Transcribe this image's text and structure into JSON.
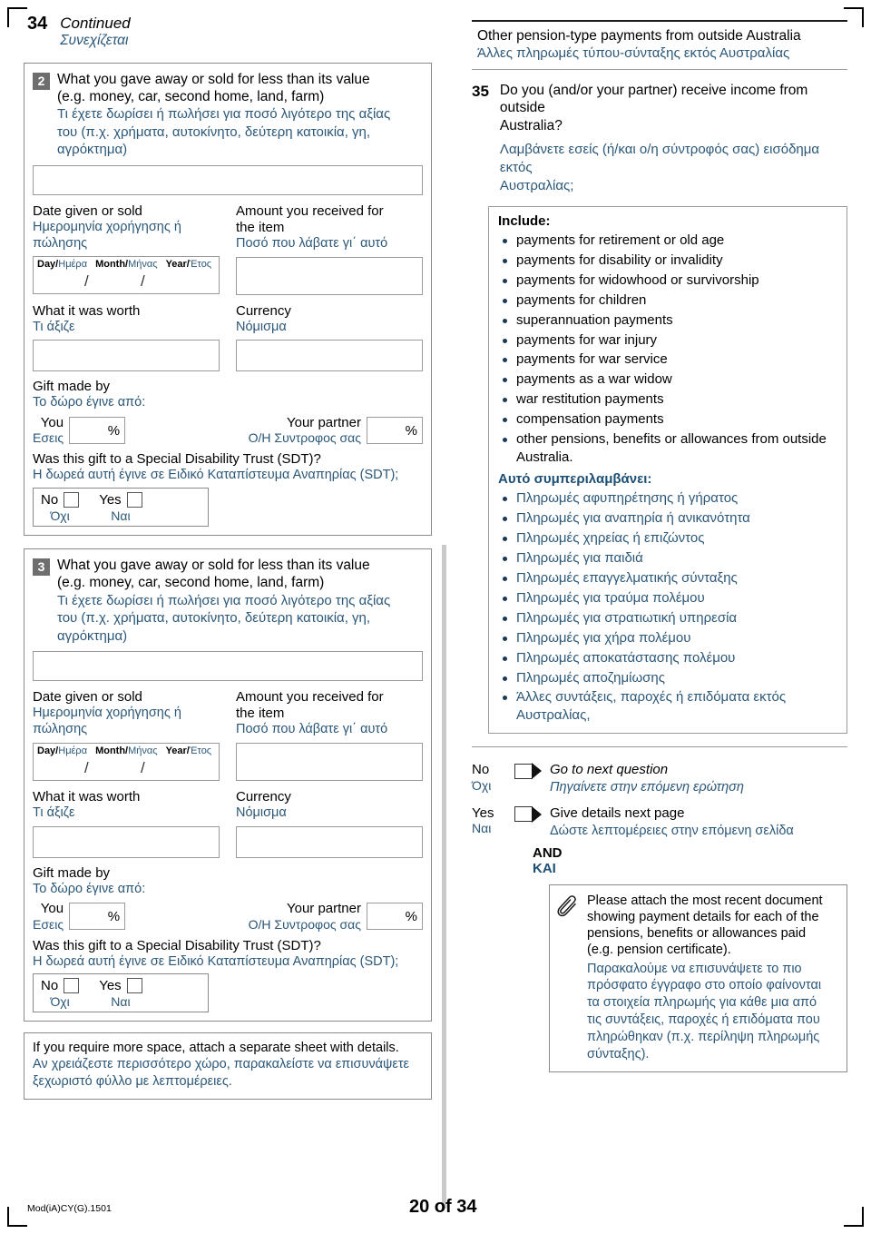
{
  "page": {
    "continued_number": "34",
    "continued_en": "Continued",
    "continued_gr": "Συνεχίζεται",
    "footer_code": "Mod(iA)CY(G).1501",
    "footer_page": "20 of 34",
    "accent_color": "#2b5778",
    "badge_color": "#6e6e6e"
  },
  "gift_labels": {
    "title_en_1": "What you gave away or sold for less than its value",
    "title_en_2": "(e.g. money, car, second home, land, farm)",
    "title_gr_1": "Τι έχετε δωρίσει ή πωλήσει για ποσό λιγότερο της αξίας",
    "title_gr_2": "του (π.χ. χρήματα, αυτοκίνητο, δεύτερη κατοικία, γη,",
    "title_gr_3": "αγρόκτημα)",
    "date_en": "Date given or sold",
    "date_gr_1": "Ημερομηνία χορήγησης ή",
    "date_gr_2": "πώλησης",
    "day_en": "Day/",
    "day_gr": "Ημέρα",
    "month_en": "Month/",
    "month_gr": "Μήνας",
    "year_en": "Year/",
    "year_gr": "Έτος",
    "amount_en_1": "Amount you received for",
    "amount_en_2": "the item",
    "amount_gr": "Ποσό που λάβατε γι΄ αυτό",
    "worth_en": "What it was worth",
    "worth_gr": "Τι άξιζε",
    "currency_en": "Currency",
    "currency_gr": "Νόμισμα",
    "giftby_en": "Gift made by",
    "giftby_gr": "Το δώρο έγινε από:",
    "you_en": "You",
    "you_gr": "Εσεις",
    "partner_en": "Your partner",
    "partner_gr": "Ο/Η Συντροφος σας",
    "percent_symbol": "%",
    "sdt_en": "Was this gift to a Special Disability Trust (SDT)?",
    "sdt_gr": "Η δωρεά αυτή έγινε σε Ειδικό Καταπίστευμα Αναπηρίας (SDT);",
    "no_en": "No",
    "no_gr": "Όχι",
    "yes_en": "Yes",
    "yes_gr": "Ναι"
  },
  "gift_items": [
    {
      "number": "2"
    },
    {
      "number": "3"
    }
  ],
  "more_space": {
    "en": "If you require more space, attach a separate sheet with details.",
    "gr_1": "Αν χρειάζεστε περισσότερο χώρο, παρακαλείστε να επισυνάψετε",
    "gr_2": "ξεχωριστό φύλλο με λεπτομέρειες."
  },
  "section": {
    "title_en": "Other pension-type payments from outside Australia",
    "title_gr": "Άλλες πληρωμές τύπου-σύνταξης εκτός Αυστραλίας"
  },
  "question35": {
    "number": "35",
    "en_1": "Do you (and/or your partner) receive income from outside",
    "en_2": "Australia?",
    "gr_1": "Λαμβάνετε εσείς (ή/και ο/η σύντροφός σας) εισόδημα εκτός",
    "gr_2": "Αυστραλίας;",
    "include_heading_en": "Include:",
    "include_heading_gr": "Αυτό συμπεριλαμβάνει:",
    "include_en": [
      "payments for retirement or old age",
      "payments for disability or invalidity",
      "payments for widowhood or survivorship",
      "payments for children",
      "superannuation payments",
      "payments for war injury",
      "payments for war service",
      "payments as a war widow",
      "war restitution payments",
      "compensation payments",
      "other pensions, benefits or allowances from outside Australia."
    ],
    "include_gr": [
      "Πληρωμές αφυπηρέτησης ή γήρατος",
      "Πληρωμές για αναπηρία ή ανικανότητα",
      "Πληρωμές χηρείας ή επιζώντος",
      "Πληρωμές για παιδιά",
      "Πληρωμές επαγγελματικής σύνταξης",
      "Πληρωμές για τραύμα πολέμου",
      "Πληρωμές για στρατιωτική υπηρεσία",
      "Πληρωμές για χήρα πολέμου",
      "Πληρωμές αποκατάστασης πολέμου",
      "Πληρωμές αποζημίωσης",
      "Άλλες συντάξεις, παροχές ή επιδόματα εκτός Αυστραλίας,"
    ],
    "answers": {
      "no_en": "No",
      "no_gr": "Όχι",
      "no_action_en": "Go to next question",
      "no_action_gr": "Πηγαίνετε στην επόμενη ερώτηση",
      "yes_en": "Yes",
      "yes_gr": "Ναι",
      "yes_action_en": "Give details next page",
      "yes_action_gr": "Δώστε λεπτομέρειες στην επόμενη σελίδα",
      "and_en": "AND",
      "and_gr": "ΚΑΙ"
    },
    "attach_note": {
      "en_1": "Please attach the most recent document",
      "en_2": "showing payment details for each of the",
      "en_3": "pensions, benefits or allowances paid",
      "en_4": "(e.g. pension certificate).",
      "gr_1": "Παρακαλούμε να επισυνάψετε το πιο",
      "gr_2": "πρόσφατο έγγραφο στο οποίο φαίνονται",
      "gr_3": "τα στοιχεία πληρωμής για κάθε μια από",
      "gr_4": "τις συντάξεις, παροχές ή επιδόματα που",
      "gr_5": "πληρώθηκαν (π.χ. περίληψη πληρωμής",
      "gr_6": "σύνταξης)."
    }
  }
}
